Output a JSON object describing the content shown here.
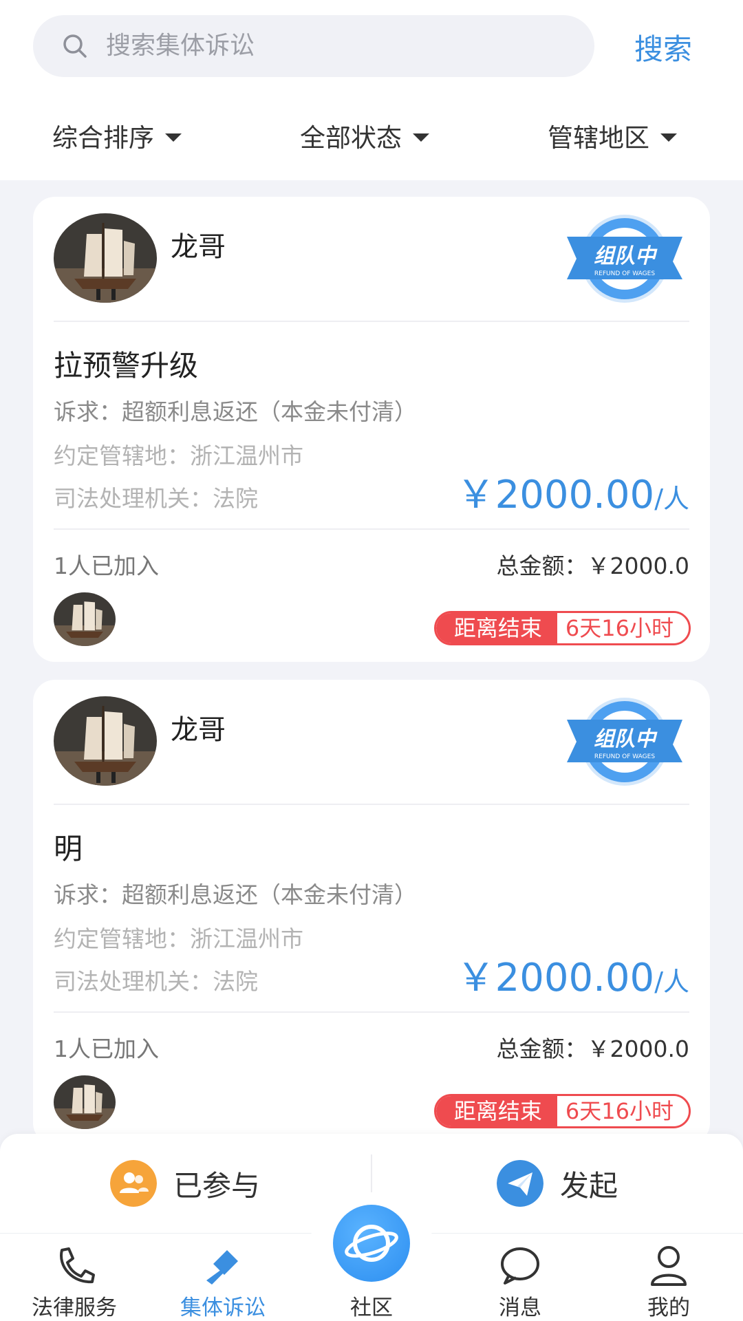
{
  "search": {
    "placeholder": "搜索集体诉讼",
    "button_label": "搜索"
  },
  "filters": {
    "sort": "综合排序",
    "status": "全部状态",
    "region": "管辖地区"
  },
  "cards": [
    {
      "user_name": "龙哥",
      "badge": {
        "text": "组队中",
        "subtext": "REFUND OF WAGES"
      },
      "title": "拉预警升级",
      "claim": "诉求：超额利息返还（本金未付清）",
      "jurisdiction": "约定管辖地：浙江温州市",
      "authority": "司法处理机关：法院",
      "price_amount": "￥2000.00",
      "price_unit": "/人",
      "joined": "1人已加入",
      "total": "总金额：￥2000.0",
      "countdown_label": "距离结束",
      "countdown_value": "6天16小时"
    },
    {
      "user_name": "龙哥",
      "badge": {
        "text": "组队中",
        "subtext": "REFUND OF WAGES"
      },
      "title": "明",
      "claim": "诉求：超额利息返还（本金未付清）",
      "jurisdiction": "约定管辖地：浙江温州市",
      "authority": "司法处理机关：法院",
      "price_amount": "￥2000.00",
      "price_unit": "/人",
      "joined": "1人已加入",
      "total": "总金额：￥2000.0",
      "countdown_label": "距离结束",
      "countdown_value": "6天16小时"
    }
  ],
  "actions": {
    "participated": "已参与",
    "initiate": "发起"
  },
  "tabs": {
    "legal": "法律服务",
    "class_action": "集体诉讼",
    "community": "社区",
    "messages": "消息",
    "mine": "我的"
  },
  "colors": {
    "accent": "#3b8fe0",
    "countdown": "#ef4b4f",
    "participated_icon": "#f6a43a"
  },
  "icons": {
    "search": "search-icon",
    "participated": "people-icon",
    "initiate": "paper-plane-icon",
    "legal": "phone-icon",
    "class_action": "gavel-icon",
    "community": "planet-icon",
    "messages": "chat-bubble-icon",
    "mine": "person-icon"
  }
}
